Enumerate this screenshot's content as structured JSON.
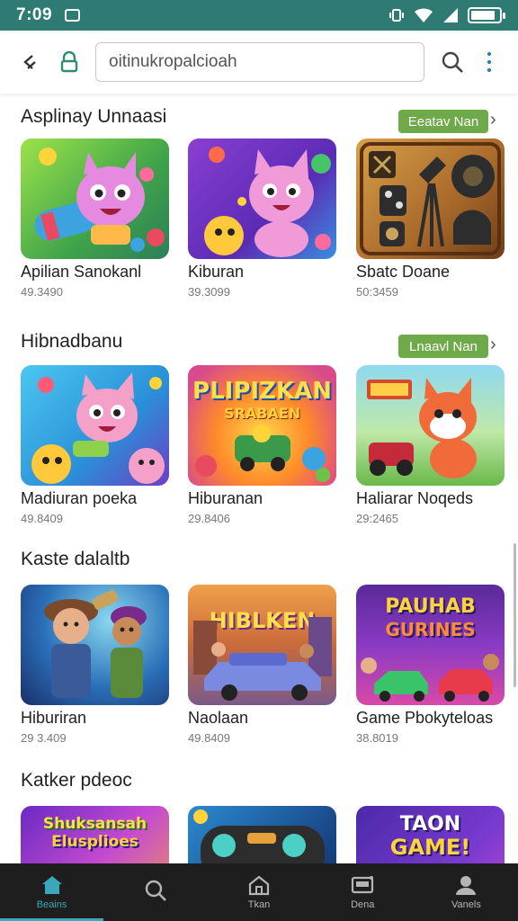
{
  "status_bar": {
    "time": "7:09"
  },
  "browser": {
    "url": "oitinukropalcioah"
  },
  "sections": [
    {
      "title": "Asplinay Unnaasi",
      "see_all": "Eeatav Nan",
      "cards": [
        {
          "title": "Apilian Sanokanl",
          "meta": "49.3490",
          "icon": "pink-creature-game-icon"
        },
        {
          "title": "Kiburan",
          "meta": "39.3099",
          "icon": "pink-cat-game-icon"
        },
        {
          "title": "Sbatc Doane",
          "meta": "50:3459",
          "icon": "studio-equipment-icon"
        }
      ]
    },
    {
      "title": "Hibnadbanu",
      "see_all": "Lnaavl Nan",
      "cards": [
        {
          "title": "Madiuran poeka",
          "meta": "49.8409",
          "icon": "pink-creature-game-icon"
        },
        {
          "title": "Hiburanan",
          "meta": "29.8406",
          "icon": "racing-game-icon"
        },
        {
          "title": "Haliarar Noqeds",
          "meta": "29:2465",
          "icon": "fox-game-icon"
        }
      ]
    },
    {
      "title": "Kaste dalaltb",
      "see_all": "",
      "cards": [
        {
          "title": "Hiburiran",
          "meta": "29 3.409",
          "icon": "cartoon-kids-icon"
        },
        {
          "title": "Naolaan",
          "meta": "49.8409",
          "icon": "car-street-icon"
        },
        {
          "title": "Game Pbokyteloas",
          "meta": "38.8019",
          "icon": "racing-cars-icon"
        }
      ]
    },
    {
      "title": "Katker pdeoc",
      "see_all": "",
      "cards": [
        {
          "title": "",
          "meta": "",
          "icon": "candy-game-icon"
        },
        {
          "title": "",
          "meta": "",
          "icon": "gamepad-icon"
        },
        {
          "title": "",
          "meta": "",
          "icon": "trophy-game-icon"
        }
      ]
    }
  ],
  "thumb_text": {
    "s1c1": "",
    "s1c2": "",
    "s1c3": "",
    "s2c2_line1": "PLIPIZKAN",
    "s2c2_line2": "SRABAEN",
    "s2c3": "",
    "s3c2": "HIBLKEN",
    "s3c3_line1": "PAUHAB",
    "s3c3_line2": "GURINES",
    "s4c1_line1": "Shuksansah",
    "s4c1_line2": "Elusplioes",
    "s4c3_line1": "TAON",
    "s4c3_line2": "GAME!"
  },
  "nav": [
    {
      "label": "Beains",
      "icon": "home-icon"
    },
    {
      "label": "",
      "icon": "search-icon"
    },
    {
      "label": "Tkan",
      "icon": "house-icon"
    },
    {
      "label": "Dena",
      "icon": "tablet-icon"
    },
    {
      "label": "Vanels",
      "icon": "profile-icon"
    }
  ],
  "colors": {
    "status_bar": "#2f7a72",
    "accent": "#3aa8b8",
    "see_all": "#6faa4a",
    "nav_bg": "#1e1e1e"
  }
}
